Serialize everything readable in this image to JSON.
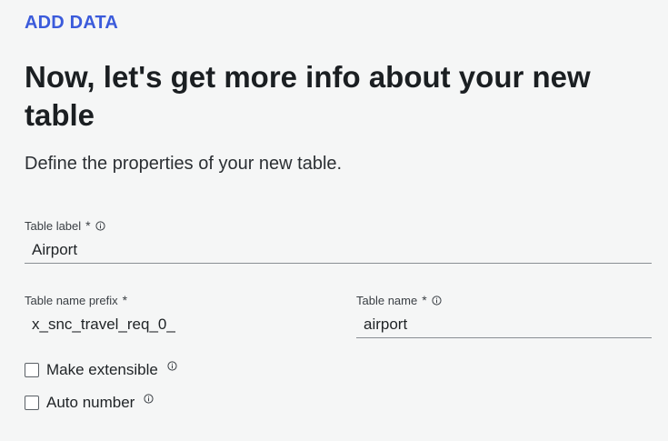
{
  "header": {
    "eyebrow": "ADD DATA",
    "title": "Now, let's get more info about your new table",
    "subtitle": "Define the properties of your new table."
  },
  "form": {
    "table_label": {
      "label": "Table label",
      "required_mark": "*",
      "value": "Airport"
    },
    "table_name_prefix": {
      "label": "Table name prefix",
      "required_mark": "*",
      "value": "x_snc_travel_req_0_"
    },
    "table_name": {
      "label": "Table name",
      "required_mark": "*",
      "value": "airport"
    },
    "make_extensible": {
      "label": "Make extensible",
      "checked": false
    },
    "auto_number": {
      "label": "Auto number",
      "checked": false
    }
  },
  "colors": {
    "accent": "#3b5bdb",
    "background": "#f5f6f6",
    "underline": "#8a8f94"
  },
  "icons": {
    "info": "info-circle-icon"
  }
}
